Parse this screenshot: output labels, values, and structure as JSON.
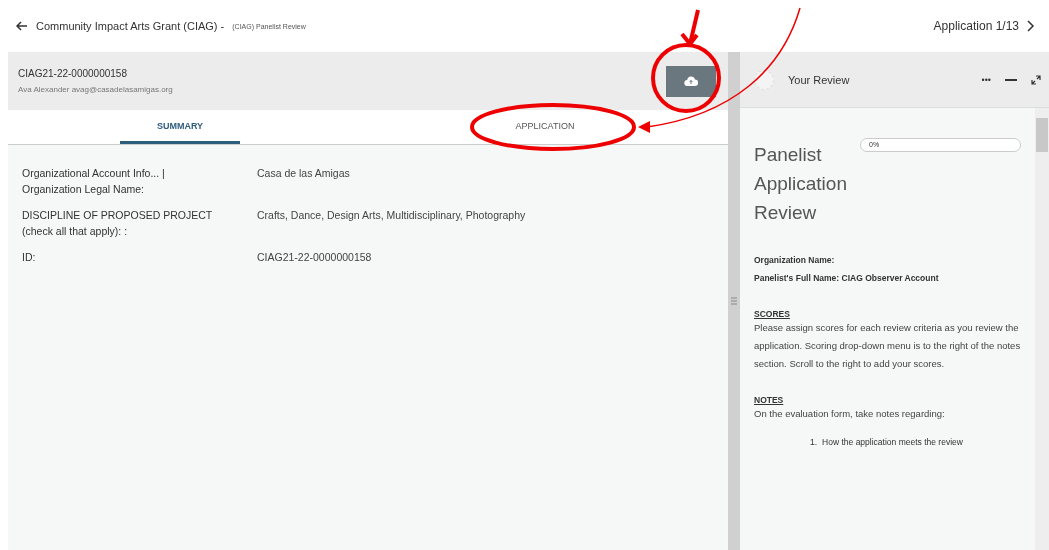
{
  "topbar": {
    "back_title": "Community Impact Arts Grant (CIAG) -",
    "subtitle": "(CIAG) Panelist Review",
    "counter": "Application 1/13"
  },
  "record": {
    "id": "CIAG21-22-0000000158",
    "contact": "Ava Alexander avag@casadelasamigas.org"
  },
  "tabs": [
    {
      "label": "SUMMARY",
      "selected": true
    },
    {
      "label": "APPLICATION",
      "selected": false
    }
  ],
  "fields": [
    {
      "label": "Organizational Account Info... | Organization Legal Name:",
      "value": "Casa de las Amigas"
    },
    {
      "label": "DISCIPLINE OF PROPOSED PROJECT (check all that apply): :",
      "value": "Crafts, Dance, Design Arts, Multidisciplinary, Photography"
    },
    {
      "label": "ID:",
      "value": "CIAG21-22-0000000158"
    }
  ],
  "review": {
    "title": "Your Review",
    "menu": "•••",
    "form_title": "Panelist Application Review",
    "progress": {
      "level": 0,
      "reading": "0%"
    },
    "lines": [
      "Organization Name:",
      "Panelist's Full Name: CIAG Observer Account"
    ],
    "sections": [
      {
        "heading": "SCORES",
        "text": "Please assign scores for each review criteria as you review the application. Scoring drop-down menu is to the right of the notes section. Scroll to the right to add your scores."
      },
      {
        "heading": "NOTES",
        "text": "On the evaluation form, take notes regarding:"
      }
    ],
    "list": [
      {
        "marker": "1.",
        "text": "How the application meets the review"
      }
    ]
  }
}
